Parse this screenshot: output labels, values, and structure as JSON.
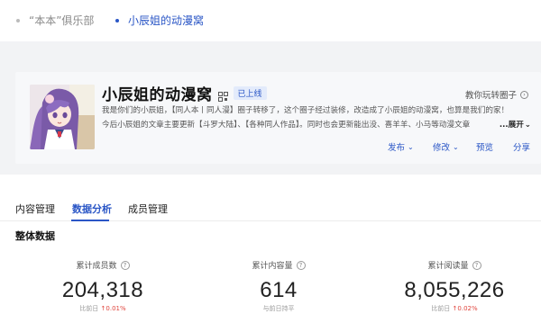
{
  "nav": {
    "items": [
      {
        "label": "“本本”俱乐部"
      },
      {
        "label": "小辰姐的动漫窝"
      }
    ]
  },
  "circle": {
    "title": "小辰姐的动漫窝",
    "badge": "已上线",
    "teach_link": "教你玩转圈子",
    "desc_line1": "我是你们的小辰姐，【同人本丨同人漫】圈子转移了，这个圈子经过装修，改造成了小辰姐的动漫窝，也算是我们的家！",
    "desc_line2": "今后小辰姐的文章主要更新【斗罗大陆】、【各种同人作品】。同时也会更新能出没、喜羊羊、小马等动漫文章",
    "expand_label": "...展开",
    "actions": {
      "publish": "发布",
      "modify": "修改",
      "preview": "预览",
      "share": "分享"
    }
  },
  "tabs": [
    {
      "label": "内容管理"
    },
    {
      "label": "数据分析"
    },
    {
      "label": "成员管理"
    }
  ],
  "section_title": "整体数据",
  "stats": [
    {
      "label": "累计成员数",
      "value": "204,318",
      "sub_prefix": "比前日",
      "sub_value": "0.01%"
    },
    {
      "label": "累计内容量",
      "value": "614",
      "sub_prefix": "与前日持平",
      "sub_value": ""
    },
    {
      "label": "累计阅读量",
      "value": "8,055,226",
      "sub_prefix": "比前日",
      "sub_value": "0.02%"
    }
  ],
  "colors": {
    "accent": "#2a56c6",
    "increase": "#e0463e"
  },
  "icons": {
    "qr": "qr-code-icon",
    "teach_arrow": "arrow-right-circle-icon",
    "help": "help-circle-icon",
    "up": "arrow-up-icon",
    "chevron": "chevron-down-icon"
  }
}
